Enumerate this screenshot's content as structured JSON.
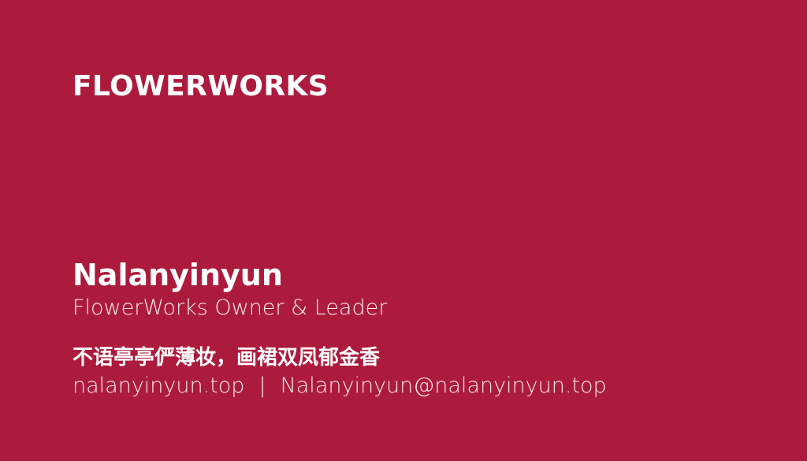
{
  "theme": {
    "background": "#AC1A3C",
    "text": "#FFFFFF"
  },
  "brand": {
    "name": "FLOWERWORKS"
  },
  "person": {
    "name": "Nalanyinyun",
    "role": "FlowerWorks Owner & Leader",
    "quote": "不语亭亭俨薄妆，画裙双凤郁金香",
    "website": "nalanyinyun.top",
    "separator": "|",
    "email": "Nalanyinyun@nalanyinyun.top"
  }
}
